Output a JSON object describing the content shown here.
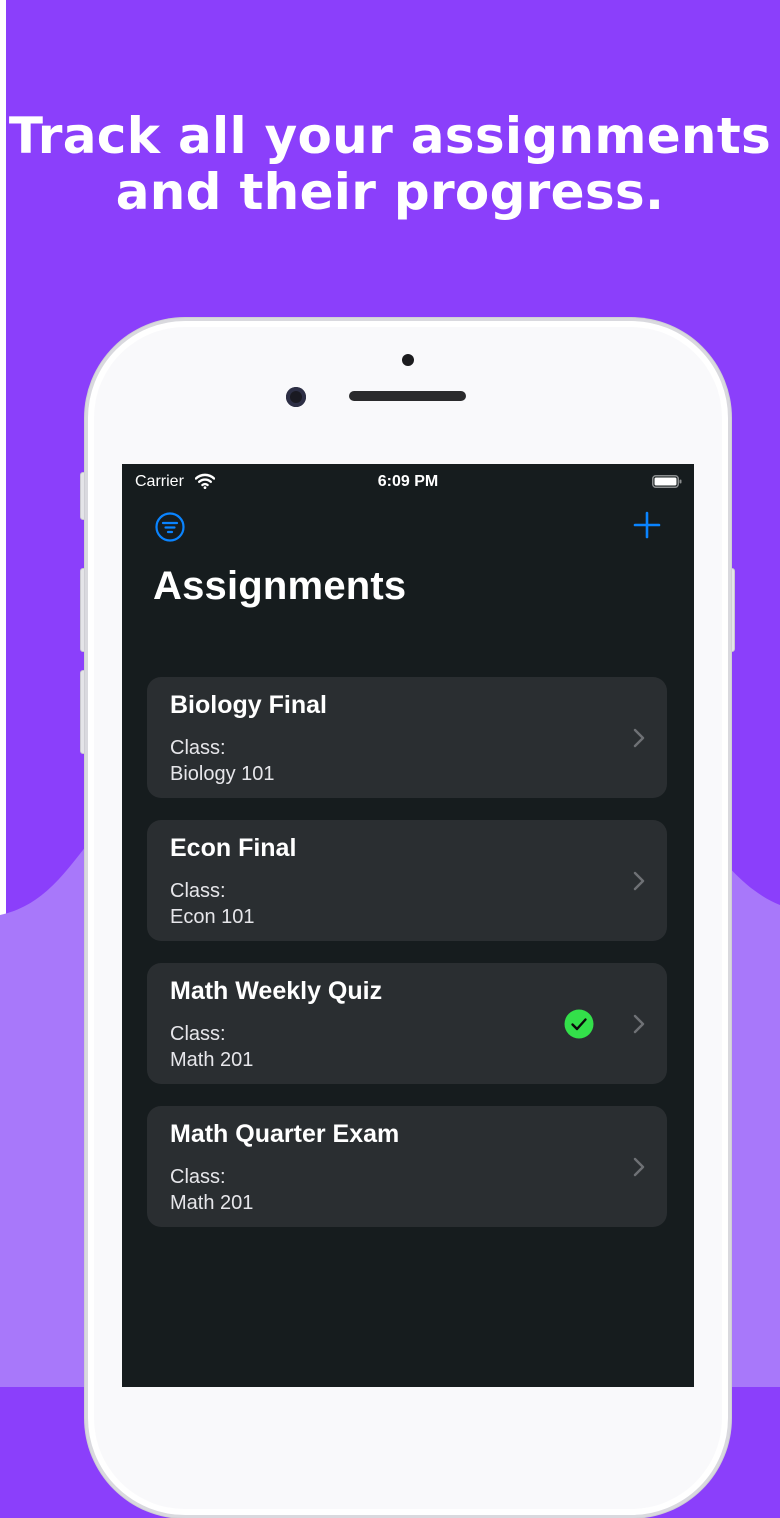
{
  "promo": {
    "headline_line1": "Track all your assignments",
    "headline_line2": "and their progress."
  },
  "colors": {
    "background": "#8b3ffb",
    "background_wave": "#a878fa",
    "screen": "#161c1e",
    "card": "#2a2e31",
    "accent": "#0a84ff",
    "complete": "#33e04a"
  },
  "status_bar": {
    "carrier": "Carrier",
    "time": "6:09 PM"
  },
  "nav": {
    "filter_icon": "filter-icon",
    "add_icon": "plus-icon",
    "title": "Assignments"
  },
  "assignments": [
    {
      "title": "Biology Final",
      "class_label": "Class:",
      "class_name": "Biology 101",
      "completed": false
    },
    {
      "title": "Econ Final",
      "class_label": "Class:",
      "class_name": "Econ 101",
      "completed": false
    },
    {
      "title": "Math Weekly Quiz",
      "class_label": "Class:",
      "class_name": "Math 201",
      "completed": true
    },
    {
      "title": "Math Quarter Exam",
      "class_label": "Class:",
      "class_name": "Math 201",
      "completed": false
    }
  ]
}
